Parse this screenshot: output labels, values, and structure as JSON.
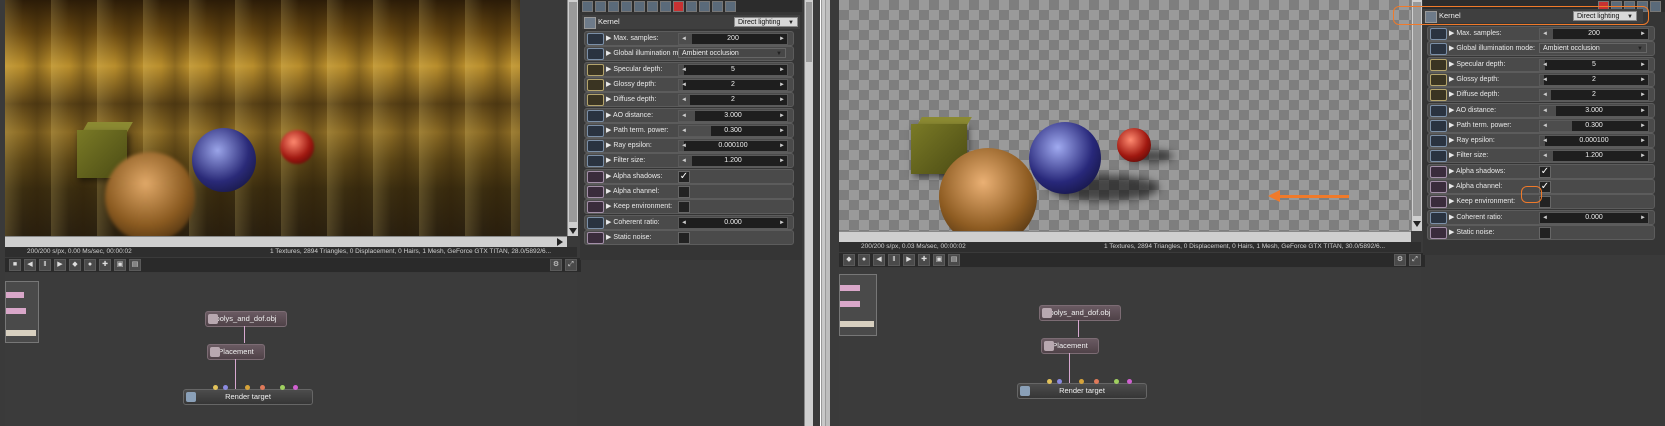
{
  "left": {
    "status_text": "200/200 s/px, 0.00 Ms/sec, 00:00:02",
    "scene_info": "1 Textures, 2894 Triangles, 0 Displacement, 0 Hairs, 1 Mesh, GeForce GTX TITAN, 28.0/5892/6...",
    "kernel": {
      "label": "Kernel",
      "value": "Direct lighting"
    },
    "params": [
      {
        "label": "Max. samples:",
        "type": "number",
        "value": "200",
        "fill": 0.12,
        "icon": "b"
      },
      {
        "label": "Global illumination mode:",
        "type": "dropdown",
        "value": "Ambient occlusion",
        "icon": "b"
      },
      {
        "label": "Specular depth:",
        "type": "number",
        "value": "5",
        "fill": 0.05,
        "icon": "y"
      },
      {
        "label": "Glossy depth:",
        "type": "number",
        "value": "2",
        "fill": 0.04,
        "icon": "y"
      },
      {
        "label": "Diffuse depth:",
        "type": "number",
        "value": "2",
        "fill": 0.1,
        "icon": "y"
      },
      {
        "label": "AO distance:",
        "type": "number",
        "value": "3.000",
        "fill": 0.15,
        "icon": "b"
      },
      {
        "label": "Path term. power:",
        "type": "number",
        "value": "0.300",
        "fill": 0.3,
        "icon": "b"
      },
      {
        "label": "Ray epsilon:",
        "type": "number",
        "value": "0.000100",
        "fill": 0.05,
        "icon": "b"
      },
      {
        "label": "Filter size:",
        "type": "number",
        "value": "1.200",
        "fill": 0.12,
        "icon": "b"
      },
      {
        "label": "Alpha shadows:",
        "type": "checkbox",
        "checked": true,
        "icon": "p"
      },
      {
        "label": "Alpha channel:",
        "type": "checkbox",
        "checked": false,
        "icon": "p"
      },
      {
        "label": "Keep environment:",
        "type": "checkbox",
        "checked": false,
        "icon": "p"
      },
      {
        "label": "Coherent ratio:",
        "type": "number",
        "value": "0.000",
        "fill": 0.0,
        "icon": "b"
      },
      {
        "label": "Static noise:",
        "type": "checkbox",
        "checked": false,
        "icon": "p"
      }
    ],
    "nodes": {
      "mesh": "polys_and_dof.obj",
      "placement": "Placement",
      "render_target": "Render target"
    }
  },
  "right": {
    "status_text": "200/200 s/px, 0.03 Ms/sec, 00:00:02",
    "scene_info": "1 Textures, 2894 Triangles, 0 Displacement, 0 Hairs, 1 Mesh, GeForce GTX TITAN, 30.0/5892/6...",
    "kernel": {
      "label": "Kernel",
      "value": "Direct lighting"
    },
    "params": [
      {
        "label": "Max. samples:",
        "type": "number",
        "value": "200",
        "fill": 0.12,
        "icon": "b"
      },
      {
        "label": "Global illumination mode:",
        "type": "dropdown",
        "value": "Ambient occlusion",
        "icon": "b"
      },
      {
        "label": "Specular depth:",
        "type": "number",
        "value": "5",
        "fill": 0.05,
        "icon": "y"
      },
      {
        "label": "Glossy depth:",
        "type": "number",
        "value": "2",
        "fill": 0.04,
        "icon": "y"
      },
      {
        "label": "Diffuse depth:",
        "type": "number",
        "value": "2",
        "fill": 0.1,
        "icon": "y"
      },
      {
        "label": "AO distance:",
        "type": "number",
        "value": "3.000",
        "fill": 0.15,
        "icon": "b"
      },
      {
        "label": "Path term. power:",
        "type": "number",
        "value": "0.300",
        "fill": 0.3,
        "icon": "b"
      },
      {
        "label": "Ray epsilon:",
        "type": "number",
        "value": "0.000100",
        "fill": 0.05,
        "icon": "b"
      },
      {
        "label": "Filter size:",
        "type": "number",
        "value": "1.200",
        "fill": 0.12,
        "icon": "b"
      },
      {
        "label": "Alpha shadows:",
        "type": "checkbox",
        "checked": true,
        "icon": "p"
      },
      {
        "label": "Alpha channel:",
        "type": "checkbox",
        "checked": true,
        "icon": "p"
      },
      {
        "label": "Keep environment:",
        "type": "checkbox",
        "checked": false,
        "icon": "p"
      },
      {
        "label": "Coherent ratio:",
        "type": "number",
        "value": "0.000",
        "fill": 0.0,
        "icon": "b"
      },
      {
        "label": "Static noise:",
        "type": "checkbox",
        "checked": false,
        "icon": "p"
      }
    ],
    "nodes": {
      "mesh": "polys_and_dof.obj",
      "placement": "Placement",
      "render_target": "Render target"
    }
  },
  "glyphs": {
    "check": "✓",
    "left_arrow": "◄",
    "right_arrow": "►",
    "dd_arrow": "▼",
    "expander": "▶"
  },
  "colors": {
    "highlight": "#f07a2a",
    "pin_colors": [
      "#e2c25a",
      "#d6a33a",
      "#8a8ae0",
      "#e07a5a",
      "#a0d060",
      "#d060d0"
    ]
  }
}
